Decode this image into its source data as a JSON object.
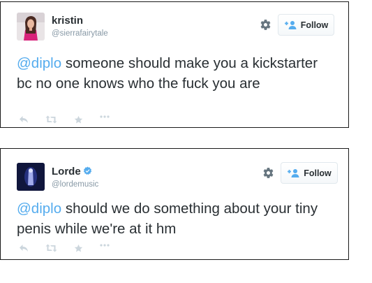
{
  "colors": {
    "link": "#55acee",
    "text": "#292f33",
    "muted": "#8899a6",
    "action_icons": "#ccd6dd",
    "verified": "#55acee"
  },
  "tweets": [
    {
      "display_name": "kristin",
      "screen_name": "@sierrafairytale",
      "verified": false,
      "follow_label": "Follow",
      "mention": "@diplo",
      "text": " someone should make you a kickstarter bc no one knows who the fuck you are",
      "icons": [
        "gear-icon",
        "follow-person-plus-icon",
        "reply-icon",
        "retweet-icon",
        "favorite-star-icon",
        "more-dots-icon"
      ]
    },
    {
      "display_name": "Lorde",
      "screen_name": "@lordemusic",
      "verified": true,
      "follow_label": "Follow",
      "mention": "@diplo",
      "text": " should we do something about your tiny penis while we're at it hm",
      "icons": [
        "verified-badge-icon",
        "gear-icon",
        "follow-person-plus-icon",
        "reply-icon",
        "retweet-icon",
        "favorite-star-icon",
        "more-dots-icon"
      ]
    }
  ]
}
